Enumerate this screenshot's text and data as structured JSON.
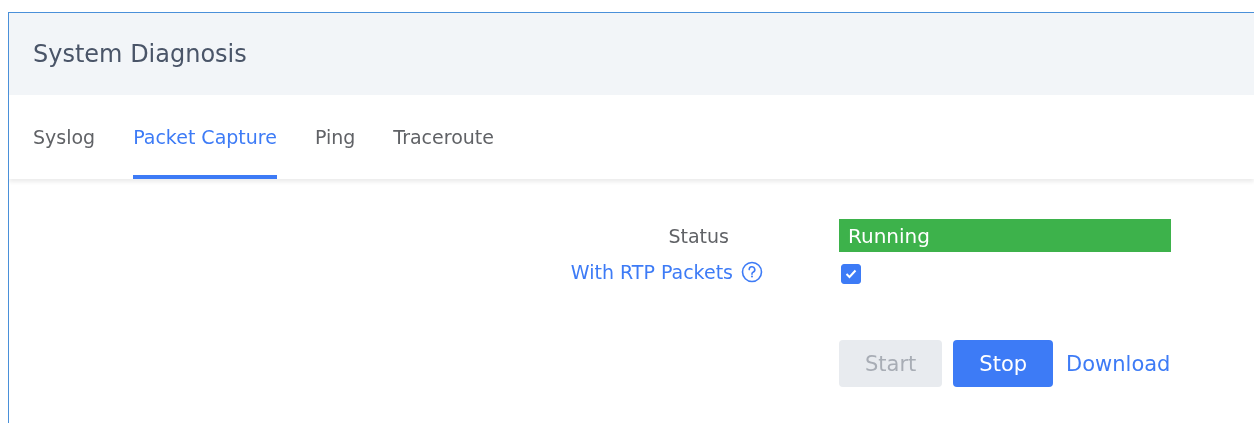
{
  "header": {
    "title": "System Diagnosis"
  },
  "tabs": [
    {
      "label": "Syslog",
      "selected": false
    },
    {
      "label": "Packet Capture",
      "selected": true
    },
    {
      "label": "Ping",
      "selected": false
    },
    {
      "label": "Traceroute",
      "selected": false
    }
  ],
  "form": {
    "status": {
      "label": "Status",
      "value": "Running"
    },
    "rtp": {
      "label": "With RTP Packets",
      "checked": true
    }
  },
  "buttons": [
    {
      "kind": "button",
      "label": "Start",
      "disabled": true
    },
    {
      "kind": "button",
      "label": "Stop",
      "disabled": false
    },
    {
      "kind": "link",
      "label": "Download",
      "disabled": false
    }
  ]
}
